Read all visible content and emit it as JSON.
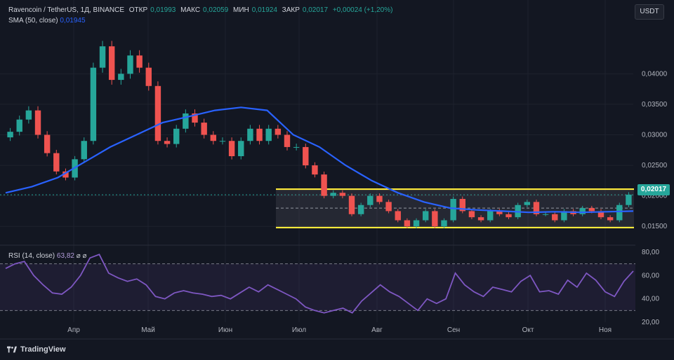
{
  "header": {
    "symbol": "Ravencoin / TetherUS, 1Д, BINANCE",
    "open_label": "ОТКР",
    "open": "0,01993",
    "high_label": "МАКС",
    "high": "0,02059",
    "low_label": "МИН",
    "low": "0,01924",
    "close_label": "ЗАКР",
    "close": "0,02017",
    "change": "+0,00024 (+1,20%)"
  },
  "sma": {
    "label": "SMA (50, close)",
    "value": "0,01945"
  },
  "rsi": {
    "label": "RSI (14, close)",
    "value": "63,82",
    "icons": "⌀ ⌀"
  },
  "currency_button": "USDT",
  "current_price_tag": "0,02017",
  "brand": "TradingView",
  "colors": {
    "up": "#26a69a",
    "down": "#ef5350",
    "sma": "#2962ff",
    "rsi": "#7e57c2",
    "channel": "#ffeb3b",
    "background": "#131722"
  },
  "chart_data": [
    {
      "type": "candlestick",
      "title": "Ravencoin / TetherUS, 1Д, BINANCE",
      "x_ticks": [
        "Апр",
        "Май",
        "Июн",
        "Июл",
        "Авг",
        "Сен",
        "Окт",
        "Ноя"
      ],
      "y_ticks": [
        "0,01500",
        "0,02000",
        "0,02500",
        "0,03000",
        "0,03500",
        "0,04000"
      ],
      "ylim": [
        0.0125,
        0.0475
      ],
      "close_series": [
        0.0305,
        0.0325,
        0.034,
        0.03,
        0.027,
        0.024,
        0.023,
        0.026,
        0.029,
        0.041,
        0.0445,
        0.039,
        0.04,
        0.043,
        0.041,
        0.038,
        0.029,
        0.0285,
        0.031,
        0.0335,
        0.032,
        0.03,
        0.029,
        0.029,
        0.0265,
        0.029,
        0.031,
        0.029,
        0.031,
        0.03,
        0.028,
        0.028,
        0.025,
        0.0235,
        0.02,
        0.0205,
        0.02,
        0.017,
        0.0185,
        0.02,
        0.019,
        0.0175,
        0.016,
        0.015,
        0.016,
        0.0175,
        0.015,
        0.016,
        0.0195,
        0.0175,
        0.0165,
        0.016,
        0.0175,
        0.017,
        0.0165,
        0.0185,
        0.019,
        0.017,
        0.017,
        0.016,
        0.0175,
        0.017,
        0.018,
        0.0175,
        0.0165,
        0.016,
        0.0185,
        0.0202
      ],
      "sma_series": [
        0.0205,
        0.0215,
        0.023,
        0.0255,
        0.028,
        0.03,
        0.032,
        0.033,
        0.034,
        0.0345,
        0.034,
        0.03,
        0.028,
        0.025,
        0.0225,
        0.0205,
        0.019,
        0.018,
        0.0177,
        0.0175,
        0.0173,
        0.0174,
        0.0173,
        0.0174,
        0.0175
      ],
      "channel": {
        "upper": 0.0211,
        "lower": 0.0148,
        "mid": 0.018
      },
      "last_price": 0.02017
    },
    {
      "type": "line",
      "title": "RSI (14, close)",
      "y_ticks": [
        "20,00",
        "40,00",
        "60,00",
        "80,00"
      ],
      "ylim": [
        20,
        80
      ],
      "bands": [
        30,
        70
      ],
      "values": [
        66,
        70,
        72,
        60,
        52,
        45,
        44,
        50,
        60,
        75,
        78,
        62,
        58,
        55,
        57,
        52,
        42,
        40,
        45,
        47,
        45,
        44,
        42,
        43,
        40,
        45,
        50,
        46,
        52,
        48,
        44,
        40,
        33,
        30,
        28,
        30,
        32,
        28,
        38,
        45,
        52,
        46,
        42,
        36,
        30,
        40,
        36,
        40,
        62,
        52,
        46,
        42,
        50,
        48,
        46,
        55,
        60,
        46,
        47,
        44,
        56,
        50,
        62,
        56,
        46,
        42,
        55,
        63.82
      ]
    }
  ]
}
